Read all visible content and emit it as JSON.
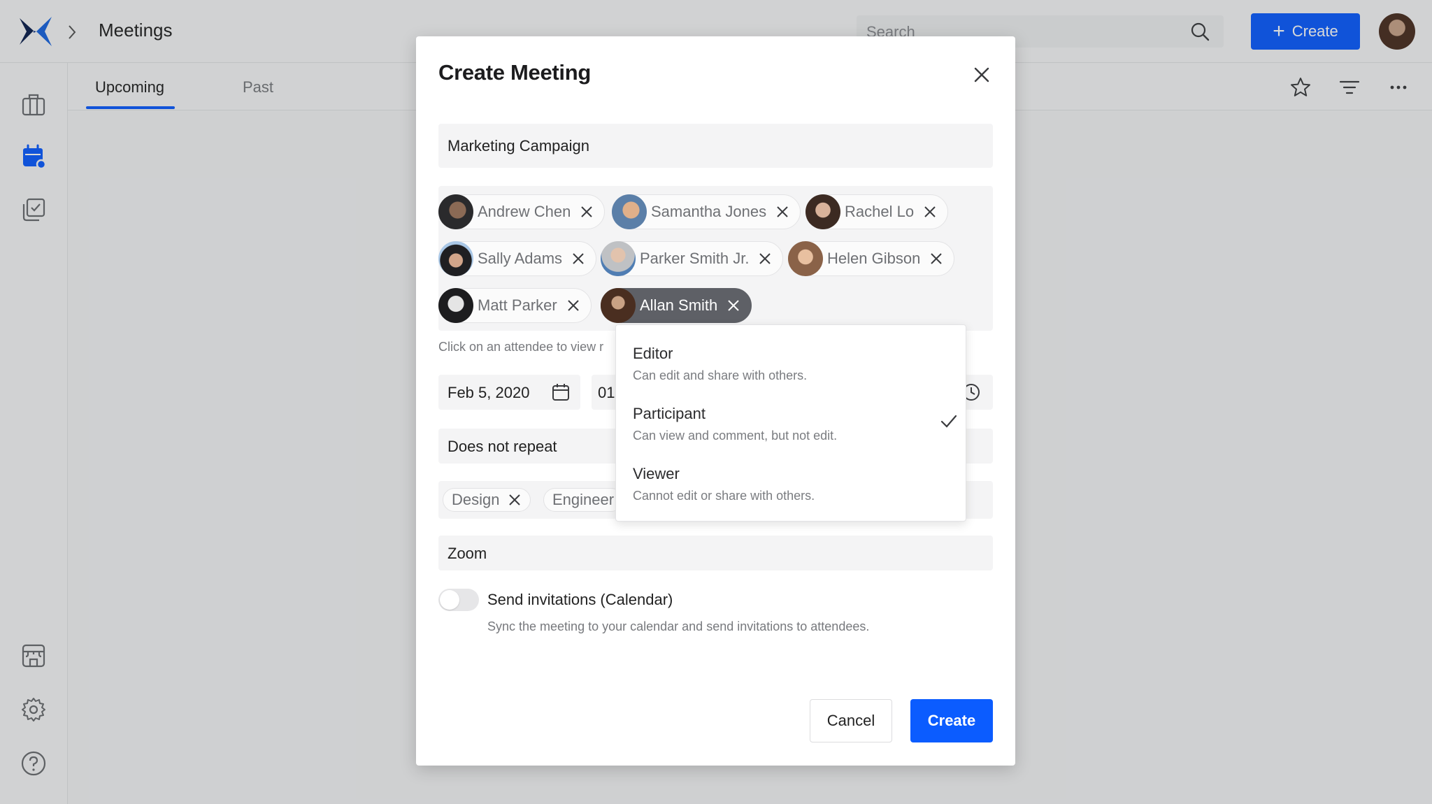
{
  "app": {
    "breadcrumb": {
      "separator_icon": "chevron-right-icon",
      "title": "Meetings"
    },
    "search": {
      "placeholder": "Search"
    },
    "create_button": {
      "label": "Create",
      "icon": "plus-icon"
    },
    "sidebar": {
      "top_items": [
        {
          "name": "briefcase",
          "icon": "briefcase-icon",
          "active": false
        },
        {
          "name": "meetings",
          "icon": "calendar-icon",
          "active": true
        },
        {
          "name": "tasks",
          "icon": "checklist-icon",
          "active": false
        }
      ],
      "bottom_items": [
        {
          "name": "store",
          "icon": "store-icon"
        },
        {
          "name": "settings",
          "icon": "gear-icon"
        },
        {
          "name": "help",
          "icon": "help-icon"
        }
      ]
    },
    "tabs": [
      {
        "label": "Upcoming",
        "active": true
      },
      {
        "label": "Past",
        "active": false
      }
    ],
    "toolbar_icons": [
      "star-icon",
      "filter-icon",
      "more-icon"
    ],
    "accent_color": "#0b5cff"
  },
  "modal": {
    "title": "Create Meeting",
    "meeting_name": "Marketing Campaign",
    "attendees": [
      {
        "name": "Andrew Chen",
        "selected": false
      },
      {
        "name": "Samantha Jones",
        "selected": false
      },
      {
        "name": "Rachel Lo",
        "selected": false
      },
      {
        "name": "Sally Adams",
        "selected": false
      },
      {
        "name": "Parker Smith Jr.",
        "selected": false
      },
      {
        "name": "Helen Gibson",
        "selected": false
      },
      {
        "name": "Matt Parker",
        "selected": false
      },
      {
        "name": "Allan Smith",
        "selected": true
      }
    ],
    "helper_text": "Click on an attendee to view r",
    "date": "Feb 5, 2020",
    "time_partial": "01",
    "repeat": "Does not repeat",
    "tags": [
      {
        "label": "Design"
      },
      {
        "label": "Engineer"
      }
    ],
    "location": "Zoom",
    "send_invitations": {
      "label": "Send invitations (Calendar)",
      "description": "Sync the meeting to your calendar and send invitations to attendees.",
      "enabled": false
    },
    "cancel_label": "Cancel",
    "create_label": "Create"
  },
  "role_dropdown": {
    "options": [
      {
        "label": "Editor",
        "description": "Can edit and share with others.",
        "selected": false
      },
      {
        "label": "Participant",
        "description": "Can view and comment, but not edit.",
        "selected": true
      },
      {
        "label": "Viewer",
        "description": "Cannot edit or share with others.",
        "selected": false
      }
    ]
  }
}
